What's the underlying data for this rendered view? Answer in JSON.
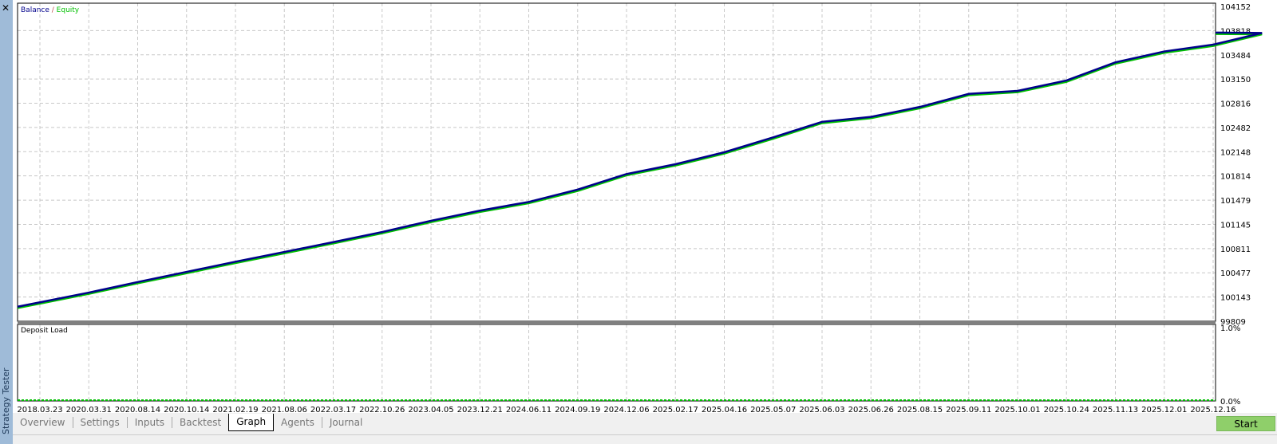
{
  "window": {
    "title": "Strategy Tester",
    "close_icon": "close-icon"
  },
  "tabs": [
    {
      "label": "Overview"
    },
    {
      "label": "Settings"
    },
    {
      "label": "Inputs"
    },
    {
      "label": "Backtest"
    },
    {
      "label": "Graph",
      "active": true
    },
    {
      "label": "Agents"
    },
    {
      "label": "Journal"
    }
  ],
  "start_label": "Start",
  "colors": {
    "balance": "#00008b",
    "equity": "#00c000",
    "start_button": "#8fcf6a",
    "sidebar": "#9fbbd8"
  },
  "chart_data": [
    {
      "type": "line",
      "legend": {
        "balance": "Balance",
        "separator": " / ",
        "equity": "Equity"
      },
      "legend_position": "top-left",
      "grid": true,
      "yticks": [
        "104152",
        "103818",
        "103484",
        "103150",
        "102816",
        "102482",
        "102148",
        "101814",
        "101479",
        "101145",
        "100811",
        "100477",
        "100143",
        "99809"
      ],
      "ylim": [
        99809,
        104152
      ],
      "xticks": [
        "2018.03.23",
        "2020.03.31",
        "2020.08.14",
        "2020.10.14",
        "2021.02.19",
        "2021.08.06",
        "2022.03.17",
        "2022.10.26",
        "2023.04.05",
        "2023.12.21",
        "2024.06.11",
        "2024.09.19",
        "2024.12.06",
        "2025.02.17",
        "2025.04.16",
        "2025.05.07",
        "2025.06.03",
        "2025.06.26",
        "2025.08.15",
        "2025.09.11",
        "2025.10.01",
        "2025.10.24",
        "2025.11.13",
        "2025.12.01",
        "2025.12.16"
      ],
      "series": [
        {
          "name": "Balance",
          "values": [
            100070,
            100204,
            100350,
            100490,
            100630,
            100765,
            100900,
            101040,
            101195,
            101335,
            101455,
            101625,
            101840,
            101975,
            102140,
            102345,
            102560,
            102628,
            102765,
            102945,
            102987,
            103130,
            103380,
            103530,
            103625,
            103785
          ]
        },
        {
          "name": "Equity",
          "values": [
            100060,
            100195,
            100340,
            100480,
            100620,
            100755,
            100890,
            101030,
            101185,
            101325,
            101445,
            101615,
            101830,
            101965,
            102130,
            102335,
            102550,
            102618,
            102755,
            102935,
            102977,
            103120,
            103370,
            103520,
            103615,
            103775
          ]
        }
      ]
    },
    {
      "type": "area",
      "title": "Deposit Load",
      "yticks": [
        "1.0%",
        "0.0%"
      ],
      "ylim": [
        0,
        1.0
      ],
      "values": [
        0
      ]
    }
  ]
}
